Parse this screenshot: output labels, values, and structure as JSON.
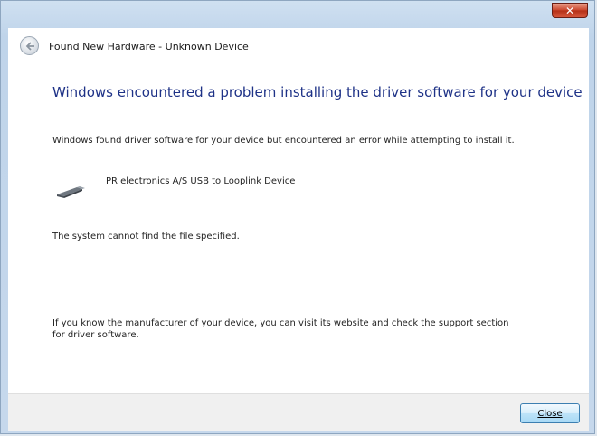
{
  "window": {
    "title": "Found New Hardware - Unknown Device",
    "close_glyph": "✕"
  },
  "content": {
    "heading": "Windows encountered a problem installing the driver software for your device",
    "message": "Windows found driver software for your device but encountered an error while attempting to install it.",
    "device_name": "PR electronics A/S USB to Looplink Device",
    "error": "The system cannot find the file specified.",
    "help": "If you know the manufacturer of your device, you can visit its website and check the support section for driver software."
  },
  "footer": {
    "close_label": "Close"
  },
  "icons": {
    "back": "back-arrow-icon",
    "device": "usb-device-icon"
  },
  "colors": {
    "heading": "#1e3287",
    "close_button_border": "#3c7fb1",
    "title_close": "#c9432a"
  }
}
